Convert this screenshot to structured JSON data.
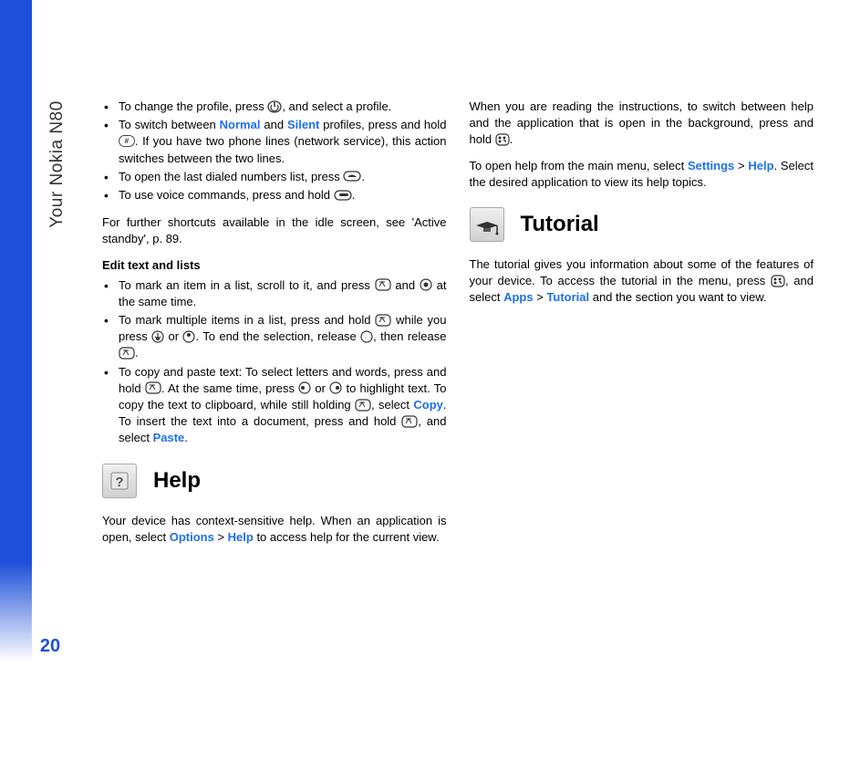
{
  "sidebar": {
    "title": "Your Nokia N80",
    "page_number": "20"
  },
  "shortcuts": {
    "items": [
      {
        "pre": "To change the profile, press ",
        "post": ", and select a profile."
      },
      {
        "pre": "To switch between ",
        "link1": "Normal",
        "mid1": " and ",
        "link2": "Silent",
        "mid2": " profiles, press and hold ",
        "post": ". If you have two phone lines (network service), this action switches between the two lines."
      },
      {
        "pre": "To open the last dialed numbers list, press ",
        "post": "."
      },
      {
        "pre": "To use voice commands, press and hold ",
        "post": "."
      }
    ],
    "footer": "For further shortcuts available in the idle screen, see 'Active standby', p. 89."
  },
  "edit": {
    "heading": "Edit text and lists",
    "items": [
      {
        "pre": "To mark an item in a list, scroll to it, and press ",
        "mid": " and ",
        "post": " at the same time."
      },
      {
        "pre": "To mark multiple items in a list, press and hold ",
        "mid1": " while you press ",
        "mid2": " or ",
        "mid3": ". To end the selection, release ",
        "mid4": ", then release ",
        "post": "."
      },
      {
        "pre": "To copy and paste text: To select letters and words, press and hold ",
        "mid1": ". At the same time, press ",
        "mid2": " or ",
        "mid3": " to highlight text. To copy the text to clipboard, while still holding ",
        "mid4": ", select ",
        "copy": "Copy",
        "mid5": ". To insert the text into a document, press and hold ",
        "mid6": ", and select ",
        "paste": "Paste",
        "post": "."
      }
    ]
  },
  "help": {
    "title": "Help",
    "p1_pre": "Your device has context-sensitive help. When an application is open, select ",
    "p1_link1": "Options",
    "p1_gt": " > ",
    "p1_link2": "Help",
    "p1_post": " to access help for the current view.",
    "p2_pre": "When you are reading the instructions, to switch between help and the application that is open in the background, press and hold ",
    "p2_post": ".",
    "p3_pre": "To open help from the main menu, select ",
    "p3_link1": "Settings",
    "p3_gt": " > ",
    "p3_link2": "Help",
    "p3_post": ". Select the desired application to view its help topics."
  },
  "tutorial": {
    "title": "Tutorial",
    "p1_pre": "The tutorial gives you information about some of the features of your device. To access the tutorial in the menu, press ",
    "p1_mid": ", and select ",
    "p1_link1": "Apps",
    "p1_gt": " > ",
    "p1_link2": "Tutorial",
    "p1_post": " and the section you want to view."
  }
}
